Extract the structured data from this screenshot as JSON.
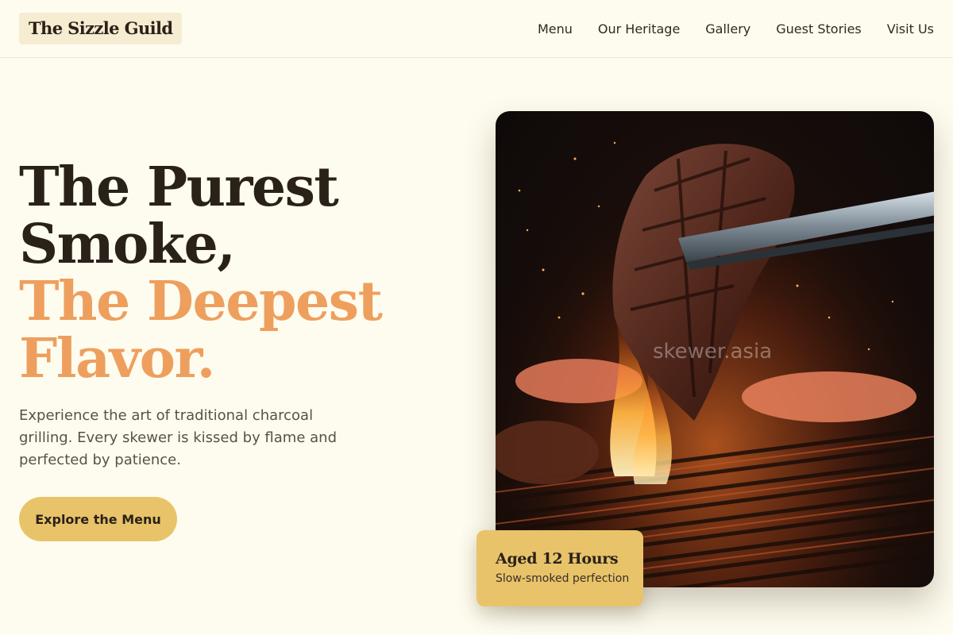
{
  "header": {
    "logo": "The Sizzle Guild",
    "nav": [
      "Menu",
      "Our Heritage",
      "Gallery",
      "Guest Stories",
      "Visit Us"
    ]
  },
  "hero": {
    "title_line1": "The Purest",
    "title_line2": "Smoke,",
    "title_line3": "The Deepest",
    "title_line4": "Flavor.",
    "subtitle": "Experience the art of traditional charcoal grilling. Every skewer is kissed by flame and perfected by patience.",
    "cta_label": "Explore the Menu"
  },
  "image": {
    "watermark": "skewer.asia"
  },
  "badge": {
    "title": "Aged 12 Hours",
    "subtitle": "Slow-smoked perfection"
  },
  "colors": {
    "background": "#fefcef",
    "accent": "#ee9f5e",
    "button": "#e8c36a",
    "text": "#2a2119"
  }
}
